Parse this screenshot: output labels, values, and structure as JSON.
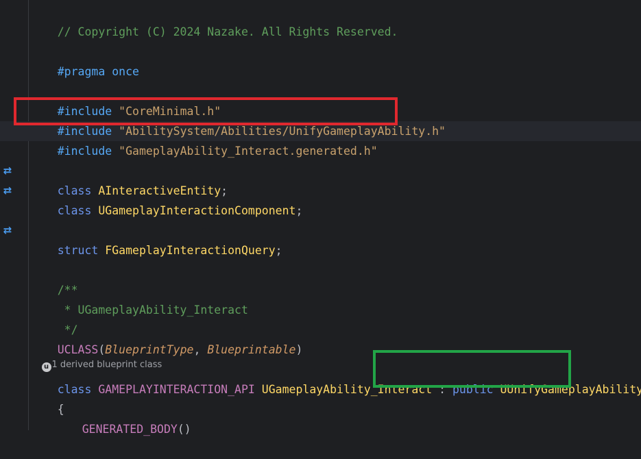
{
  "editor": {
    "lines": {
      "copyright": "// Copyright (C) 2024 Nazake. All Rights Reserved.",
      "pragma_kw": "#pragma",
      "pragma_val": " once",
      "include1_kw": "#include",
      "include1_val": "\"CoreMinimal.h\"",
      "include2_kw": "#include",
      "include2_val": "\"AbilitySystem/Abilities/UnifyGameplayAbility.h\"",
      "include3_kw": "#include",
      "include3_val": "\"GameplayAbility_Interact.generated.h\"",
      "class1_kw": "class",
      "class1_name": "AInteractiveEntity",
      "class2_kw": "class",
      "class2_name": "UGameplayInteractionComponent",
      "struct_kw": "struct",
      "struct_name": "FGameplayInteractionQuery",
      "semicolon": ";",
      "doc_open": "/**",
      "doc_body": " * UGameplayAbility_Interact",
      "doc_close": " */",
      "uclass_macro": "UCLASS",
      "uclass_open": "(",
      "uclass_arg1": "BlueprintType",
      "uclass_sep": ", ",
      "uclass_arg2": "Blueprintable",
      "uclass_close": ")",
      "hint_icon": "u",
      "hint_text": "1 derived blueprint class",
      "decl_kw": "class",
      "decl_api": "GAMEPLAYINTERACTION_API",
      "decl_name": "UGameplayAbility_Interact",
      "decl_colon": " : ",
      "decl_public": "public",
      "decl_base": "UUnifyGameplayAbility",
      "brace_open": "{",
      "generated_body": "GENERATED_BODY",
      "generated_parens": "()"
    },
    "gutter_icon": "⇄",
    "colors": {
      "red_box": "#e0282e",
      "green_box": "#22a447"
    }
  }
}
